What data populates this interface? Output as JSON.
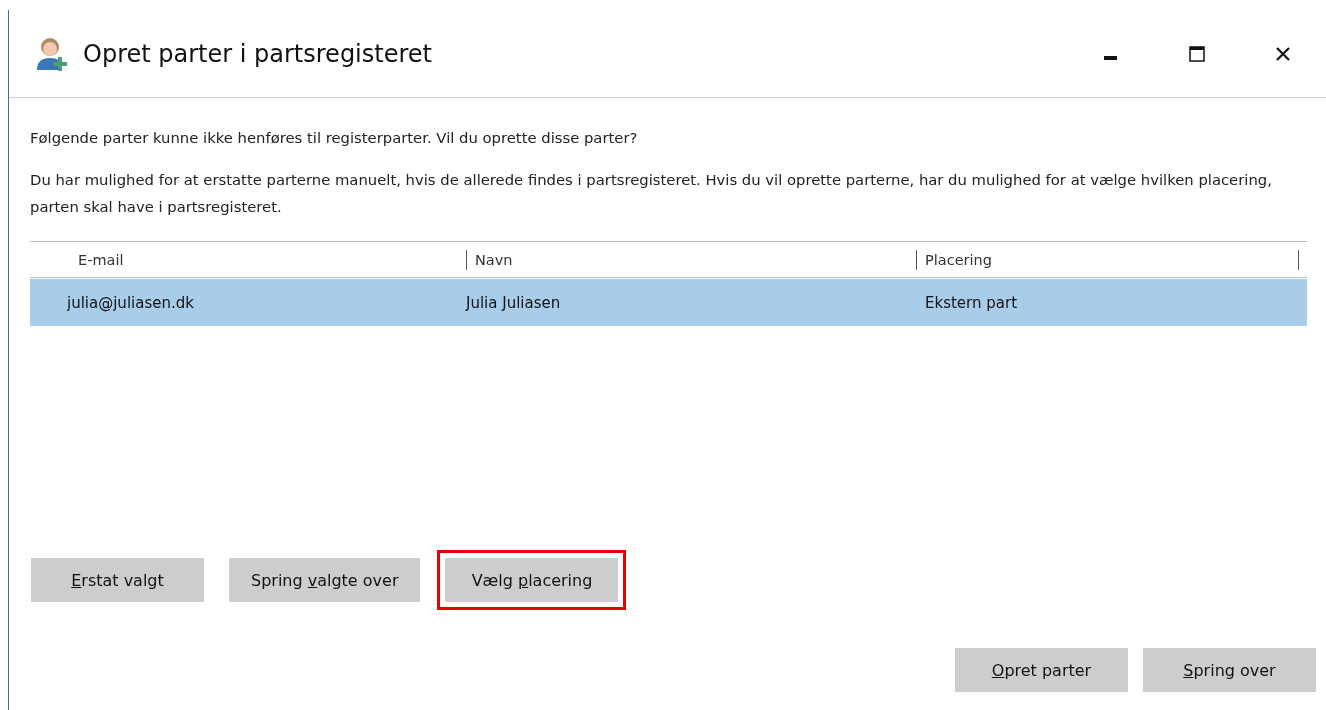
{
  "window": {
    "title": "Opret parter i partsregisteret"
  },
  "messages": [
    "Følgende parter kunne ikke henføres til registerparter. Vil du oprette disse parter?",
    "Du har mulighed for at erstatte parterne manuelt, hvis de allerede findes i partsregisteret. Hvis du vil oprette parterne, har du mulighed for at vælge hvilken placering, parten skal have i partsregisteret."
  ],
  "table": {
    "columns": [
      "E-mail",
      "Navn",
      "Placering"
    ],
    "rows": [
      {
        "cells": [
          "julia@juliasen.dk",
          "Julia Juliasen",
          "Ekstern part"
        ],
        "selected": true
      }
    ]
  },
  "action_buttons": [
    {
      "key": "E",
      "after": "rstat valgt",
      "highlighted": false
    },
    {
      "before": "Spring ",
      "key": "v",
      "after": "algte over",
      "highlighted": false
    },
    {
      "before": "Vælg ",
      "key": "p",
      "after": "lacering",
      "highlighted": true
    }
  ],
  "footer_buttons": [
    {
      "key": "O",
      "after": "pret parter"
    },
    {
      "key": "S",
      "after": "pring over"
    }
  ]
}
